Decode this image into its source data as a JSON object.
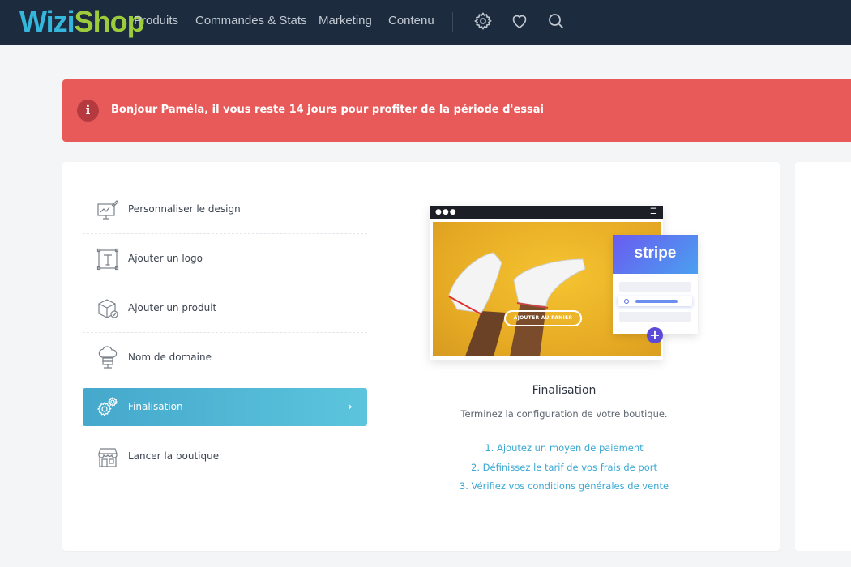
{
  "brand": {
    "part1": "Wizi",
    "part2": "Shop"
  },
  "nav": {
    "items": [
      "Produits",
      "Commandes & Stats",
      "Marketing",
      "Contenu"
    ],
    "icons": [
      "gear-icon",
      "heart-icon",
      "search-icon"
    ]
  },
  "alert": {
    "icon": "i",
    "text": "Bonjour Paméla, il vous reste 14 jours pour profiter de la période d'essai"
  },
  "steps": [
    {
      "label": "Personnaliser le design",
      "icon": "design-monitor-icon",
      "active": false
    },
    {
      "label": "Ajouter un logo",
      "icon": "text-frame-icon",
      "active": false
    },
    {
      "label": "Ajouter un produit",
      "icon": "box-icon",
      "active": false
    },
    {
      "label": "Nom de domaine",
      "icon": "cloud-server-icon",
      "active": false
    },
    {
      "label": "Finalisation",
      "icon": "gears-icon",
      "active": true
    },
    {
      "label": "Lancer la boutique",
      "icon": "storefront-icon",
      "active": false
    }
  ],
  "illustration": {
    "cta": "AJOUTER AU PANIER",
    "stripe_logo": "stripe",
    "plus": "+"
  },
  "finalisation": {
    "title": "Finalisation",
    "subtitle": "Terminez la configuration de votre boutique.",
    "links": [
      "1. Ajoutez un moyen de paiement",
      "2. Définissez le tarif de vos frais de port",
      "3. Vérifiez vos conditions générales de vente"
    ]
  },
  "colors": {
    "topbar": "#1c2b3e",
    "alert": "#e85a5a",
    "accent": "#3aa8d3",
    "active_step": "#4fb6d6"
  }
}
